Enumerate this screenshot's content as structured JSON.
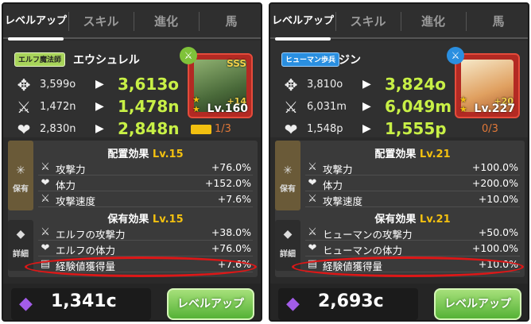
{
  "panels": [
    {
      "tabs": [
        "レベルアップ",
        "スキル",
        "進化",
        "馬"
      ],
      "class_badge": "エルフ魔法師",
      "character_name": "エウシュレル",
      "stats": [
        {
          "icon": "shield-icon",
          "old": "3,599o",
          "new": "3,613o"
        },
        {
          "icon": "sword-icon",
          "old": "1,472n",
          "new": "1,478n"
        },
        {
          "icon": "heart-icon",
          "old": "2,830n",
          "new": "2,848n"
        }
      ],
      "portrait": {
        "rarity": "SSS",
        "plus": "+14",
        "level": "Lv.160"
      },
      "progress": "1/3",
      "placement": {
        "title": "配置効果",
        "level": "Lv.15",
        "effects": [
          {
            "icon": "sword-icon",
            "name": "攻撃力",
            "value": "+76.0%"
          },
          {
            "icon": "heart-icon",
            "name": "体力",
            "value": "+152.0%"
          },
          {
            "icon": "speed-icon",
            "name": "攻撃速度",
            "value": "+7.6%"
          }
        ]
      },
      "holding": {
        "title": "保有効果",
        "level": "Lv.15",
        "effects": [
          {
            "icon": "sword-icon",
            "name": "エルフの攻撃力",
            "value": "+38.0%"
          },
          {
            "icon": "heart-icon",
            "name": "エルフの体力",
            "value": "+76.0%"
          },
          {
            "icon": "exp-icon",
            "name": "経験値獲得量",
            "value": "+7.6%"
          }
        ]
      },
      "side_hold": "保有",
      "side_detail": "詳細",
      "cost": "1,341c",
      "button": "レベルアップ"
    },
    {
      "tabs": [
        "レベルアップ",
        "スキル",
        "進化",
        "馬"
      ],
      "class_badge": "ヒューマン歩兵",
      "character_name": "ジン",
      "stats": [
        {
          "icon": "shield-icon",
          "old": "3,810o",
          "new": "3,824o"
        },
        {
          "icon": "sword-icon",
          "old": "6,031m",
          "new": "6,049m"
        },
        {
          "icon": "heart-icon",
          "old": "1,548p",
          "new": "1,555p"
        }
      ],
      "portrait": {
        "rarity": "",
        "plus": "+20",
        "level": "Lv.227"
      },
      "progress": "0/3",
      "placement": {
        "title": "配置効果",
        "level": "Lv.21",
        "effects": [
          {
            "icon": "sword-icon",
            "name": "攻撃力",
            "value": "+100.0%"
          },
          {
            "icon": "heart-icon",
            "name": "体力",
            "value": "+200.0%"
          },
          {
            "icon": "speed-icon",
            "name": "攻撃速度",
            "value": "+10.0%"
          }
        ]
      },
      "holding": {
        "title": "保有効果",
        "level": "Lv.21",
        "effects": [
          {
            "icon": "sword-icon",
            "name": "ヒューマンの攻撃力",
            "value": "+50.0%"
          },
          {
            "icon": "heart-icon",
            "name": "ヒューマンの体力",
            "value": "+100.0%"
          },
          {
            "icon": "exp-icon",
            "name": "経験値獲得量",
            "value": "+10.0%"
          }
        ]
      },
      "side_hold": "保有",
      "side_detail": "詳細",
      "cost": "2,693c",
      "button": "レベルアップ"
    }
  ],
  "colors": {
    "stat_new": "#c8f046",
    "level_accent": "#f2c010",
    "highlight_circle": "#dd1717",
    "button_green": "#55b236"
  }
}
